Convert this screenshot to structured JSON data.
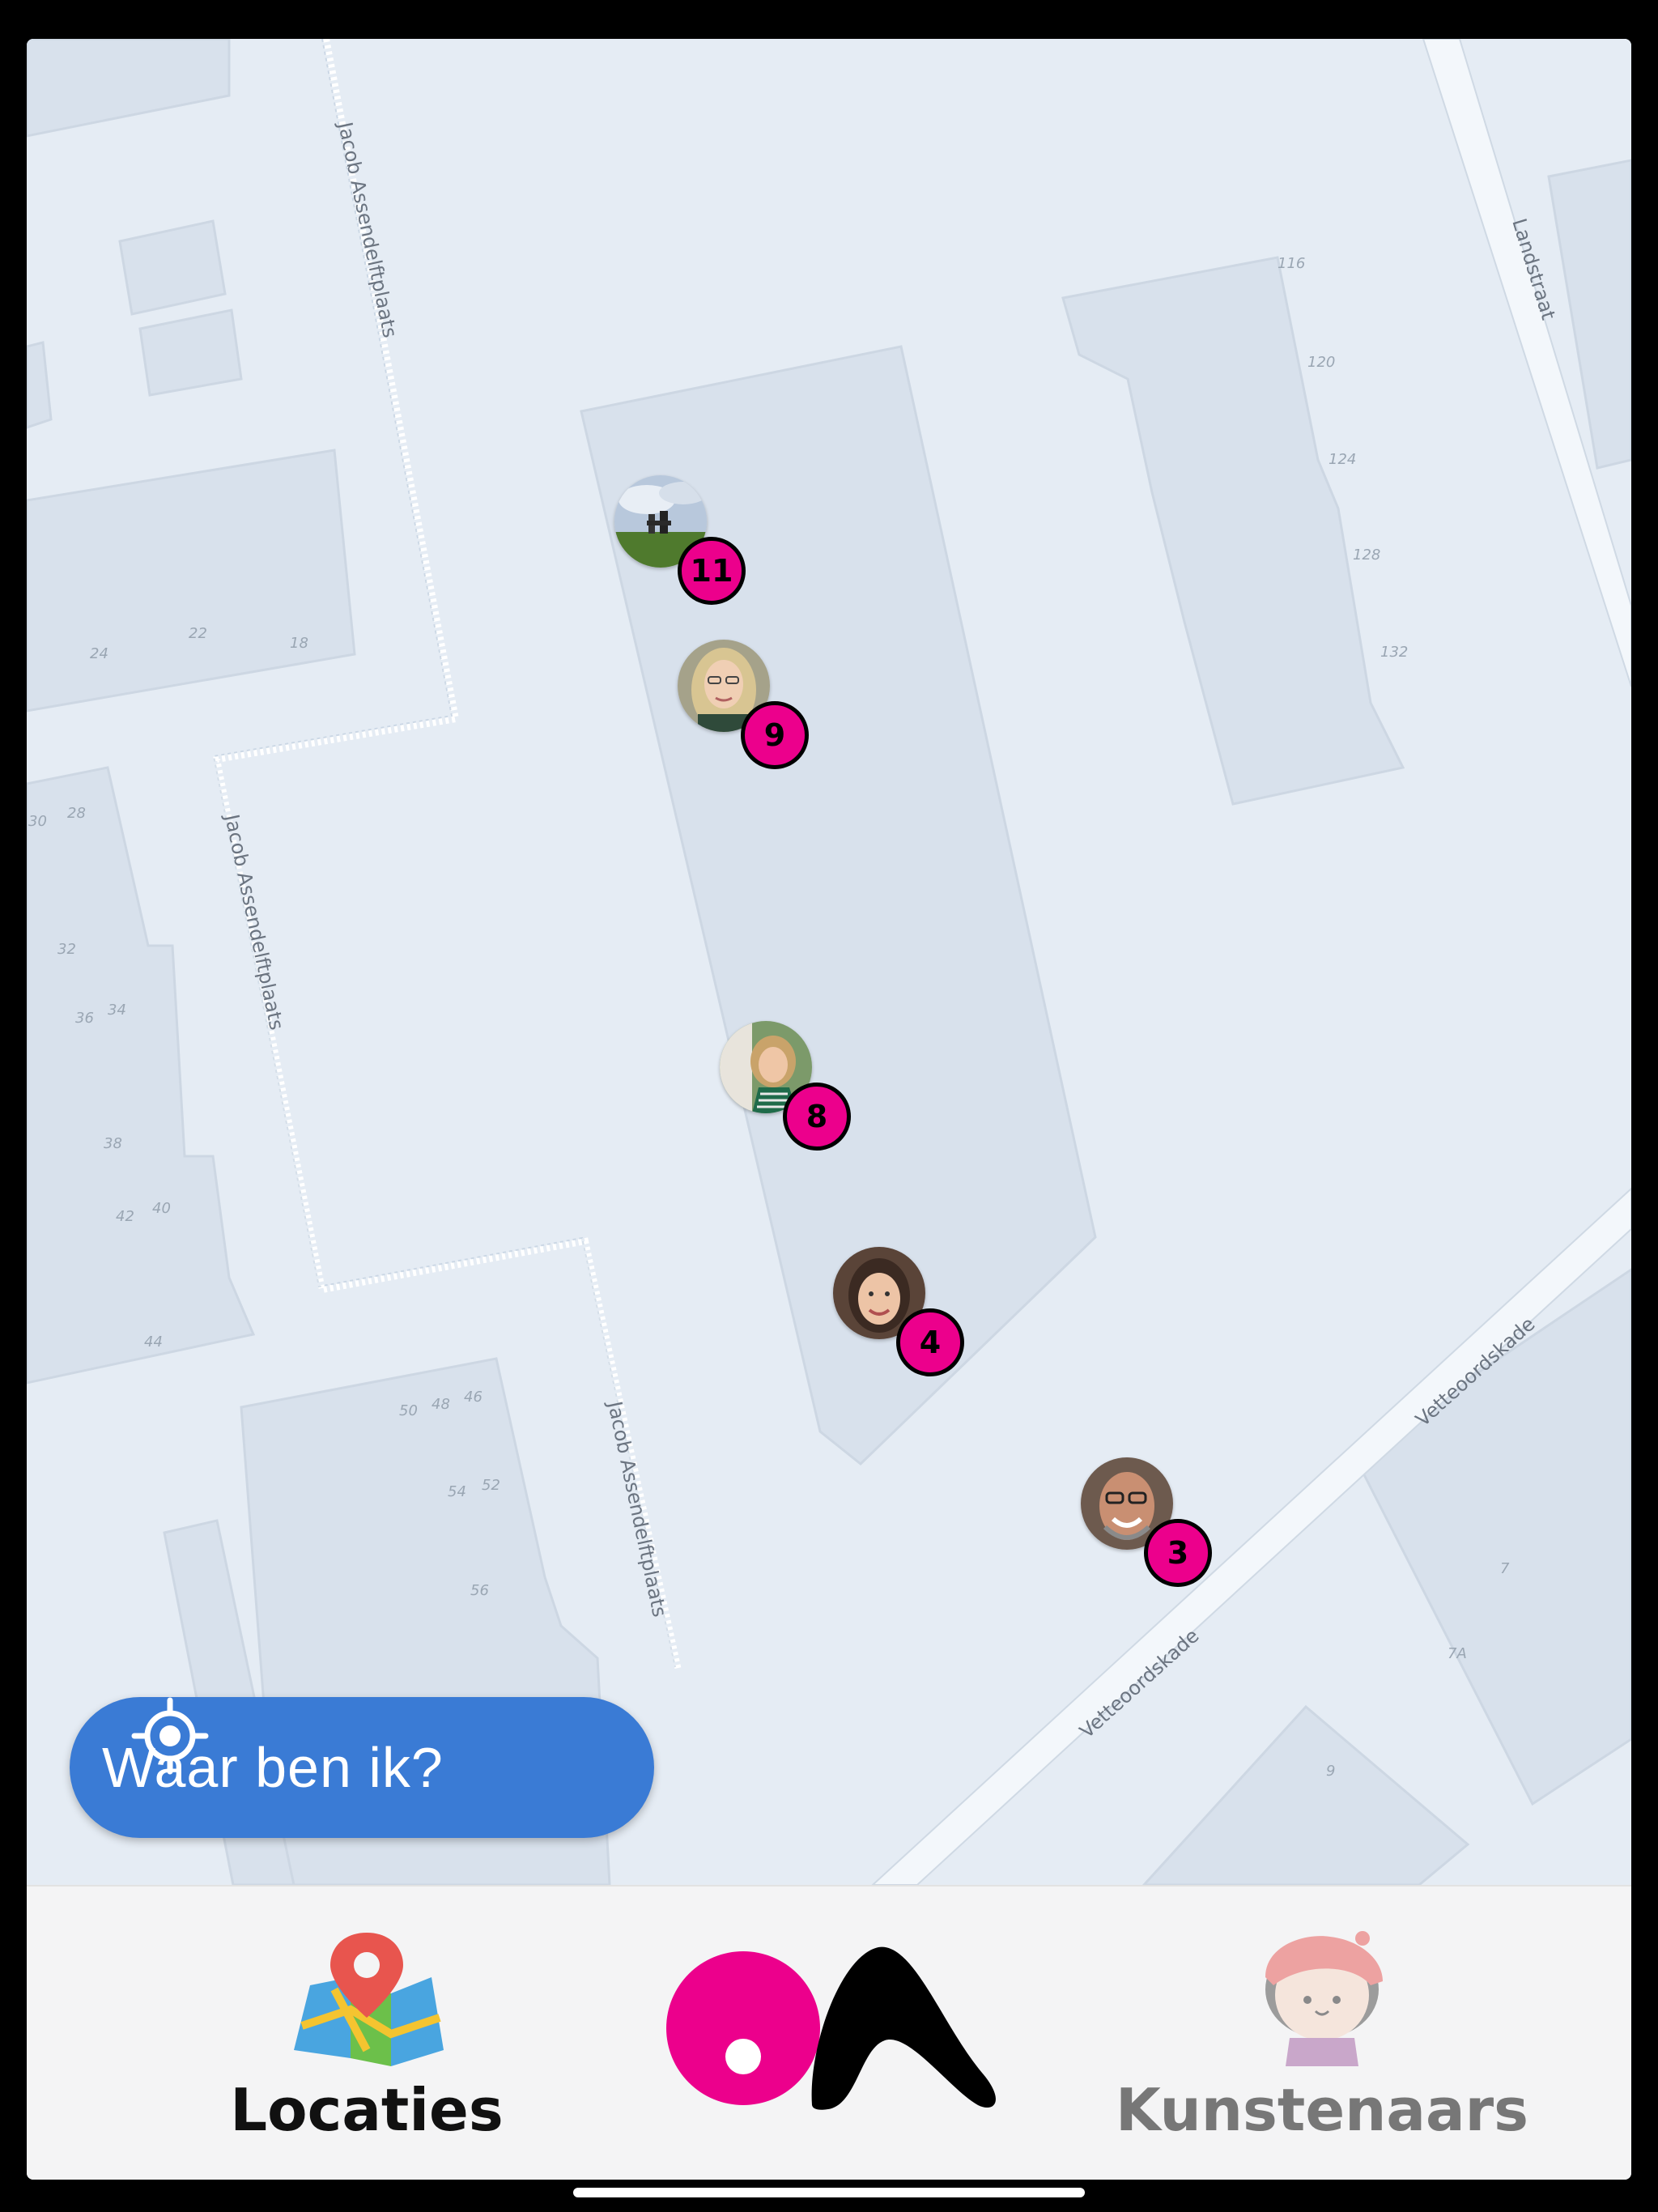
{
  "map": {
    "streets": [
      "Jacob Assendelftplaats",
      "Jacob Assendelftplaats",
      "Jacob Assendelftplaats",
      "Landstraat",
      "Vetteoordskade",
      "Vetteoordskade"
    ],
    "house_numbers": [
      "116",
      "120",
      "124",
      "128",
      "132",
      "24",
      "22",
      "18",
      "30",
      "28",
      "32",
      "36",
      "34",
      "38",
      "42",
      "40",
      "44",
      "50",
      "48",
      "46",
      "54",
      "52",
      "56",
      "7",
      "7A",
      "9"
    ],
    "markers": [
      {
        "number": "11",
        "photo": "landscape-statue"
      },
      {
        "number": "9",
        "photo": "woman-glasses"
      },
      {
        "number": "8",
        "photo": "woman-striped"
      },
      {
        "number": "4",
        "photo": "woman-dark-hair"
      },
      {
        "number": "3",
        "photo": "man-glasses"
      }
    ]
  },
  "locate_button": {
    "label": "Waar ben ik?",
    "icon": "crosshair-icon"
  },
  "tabbar": {
    "locaties": {
      "label": "Locaties",
      "icon": "map-pin-icon",
      "active": true
    },
    "logo": {
      "icon": "oa-logo"
    },
    "kunstenaars": {
      "label": "Kunstenaars",
      "icon": "artist-avatar-icon",
      "active": false
    }
  },
  "colors": {
    "accent": "#ec008c",
    "button_blue": "#3a7bd5",
    "map_bg": "#e5ecf4",
    "building": "#d8e1ec"
  }
}
